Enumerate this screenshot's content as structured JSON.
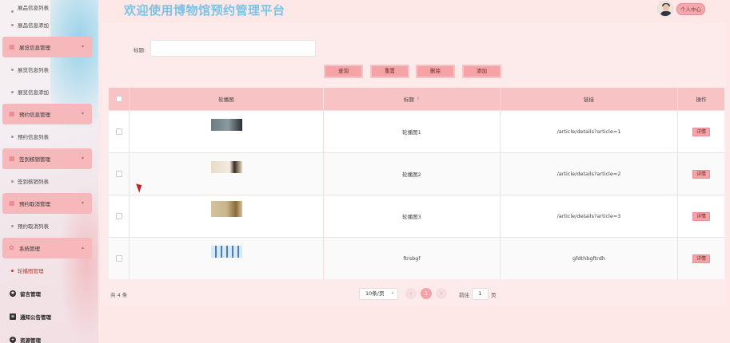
{
  "header": {
    "title": "欢迎使用博物馆预约管理平台",
    "profile_label": "个人中心"
  },
  "sidebar": {
    "items": [
      {
        "type": "sub",
        "label": "展品信息列表"
      },
      {
        "type": "sub",
        "label": "展品信息添加"
      },
      {
        "type": "group",
        "label": "展览信息管理",
        "icon": "grid-icon"
      },
      {
        "type": "sub",
        "label": "展览信息列表"
      },
      {
        "type": "sub",
        "label": "展览信息添加"
      },
      {
        "type": "group",
        "label": "预约信息管理",
        "icon": "grid-icon"
      },
      {
        "type": "sub",
        "label": "预约信息列表"
      },
      {
        "type": "group",
        "label": "签到核销管理",
        "icon": "grid-icon"
      },
      {
        "type": "sub",
        "label": "签到核销列表"
      },
      {
        "type": "group",
        "label": "预约取消管理",
        "icon": "grid-icon"
      },
      {
        "type": "sub",
        "label": "预约取消列表"
      },
      {
        "type": "group",
        "label": "系统管理",
        "icon": "gear-icon"
      },
      {
        "type": "sub",
        "label": "轮播图管理",
        "active": true
      },
      {
        "type": "top",
        "label": "留言管理",
        "icon": "gear-icon"
      },
      {
        "type": "top",
        "label": "通知公告管理",
        "icon": "document-icon"
      },
      {
        "type": "top",
        "label": "资源管理",
        "icon": "plus-icon"
      }
    ]
  },
  "search": {
    "label": "标题:",
    "value": "",
    "placeholder": ""
  },
  "actions": {
    "query": "查询",
    "reset": "重置",
    "delete": "删除",
    "add": "添加"
  },
  "table": {
    "columns": [
      "轮播图",
      "标题",
      "链接",
      "操作"
    ],
    "rows": [
      {
        "title": "轮播图1",
        "link": "/article/details?article=1",
        "action": "详情",
        "thumb_colors": [
          "#6b7b80",
          "#2a2f33"
        ]
      },
      {
        "title": "轮播图2",
        "link": "/article/details?article=2",
        "action": "详情",
        "thumb_colors": [
          "#e8dcc8",
          "#3a2c22"
        ]
      },
      {
        "title": "轮播图3",
        "link": "/article/details?article=3",
        "action": "详情",
        "thumb_colors": [
          "#d4c3a0",
          "#8a6a3a"
        ]
      },
      {
        "title": "ftrsbgf",
        "link": "gfdthbgftrdh",
        "action": "详情",
        "thumb_colors": [
          "#d9e8f5",
          "#4a7db5"
        ]
      }
    ]
  },
  "pagination": {
    "total": "共 4 条",
    "page_size": "10条/页",
    "current": "1",
    "goto_label": "前往",
    "goto_value": "1",
    "page_unit": "页"
  },
  "colors": {
    "accent": "#f5a3a6",
    "header_bg": "#f8c3c5",
    "title": "#7ac4e6"
  }
}
